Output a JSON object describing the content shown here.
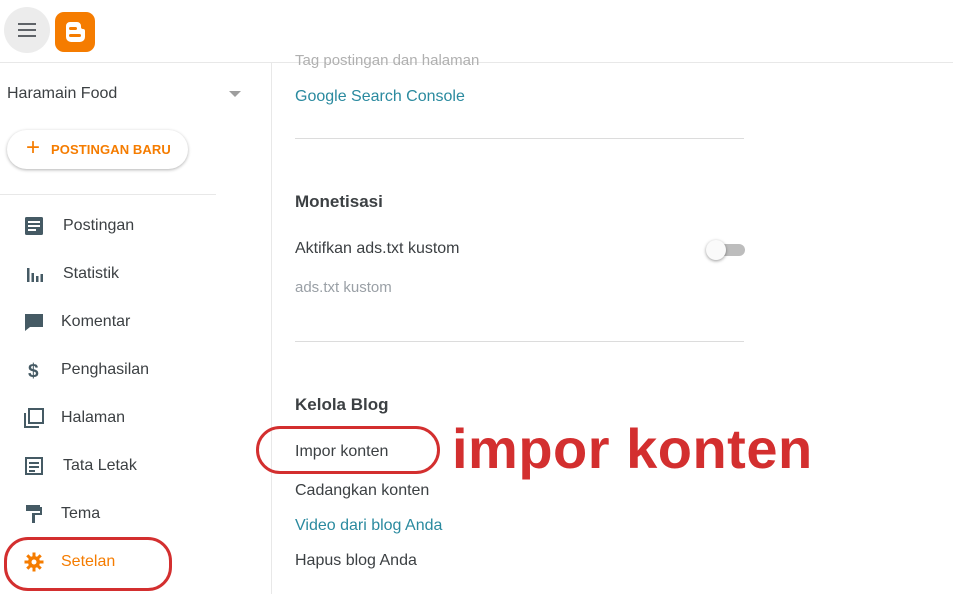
{
  "header": {
    "menu_icon": "hamburger-menu-icon",
    "logo_icon": "blogger-logo-icon",
    "logo_color": "#f57c00"
  },
  "sidebar": {
    "blog_name": "Haramain Food",
    "new_post_label": "POSTINGAN BARU",
    "items": [
      {
        "label": "Postingan",
        "icon": "posts-icon"
      },
      {
        "label": "Statistik",
        "icon": "stats-icon"
      },
      {
        "label": "Komentar",
        "icon": "comment-icon"
      },
      {
        "label": "Penghasilan",
        "icon": "dollar-icon"
      },
      {
        "label": "Halaman",
        "icon": "pages-icon"
      },
      {
        "label": "Tata Letak",
        "icon": "layout-icon"
      },
      {
        "label": "Tema",
        "icon": "theme-icon"
      },
      {
        "label": "Setelan",
        "icon": "gear-icon",
        "active": true
      }
    ]
  },
  "main": {
    "faded_text": "Tag postingan dan halaman",
    "search_console_link": "Google Search Console",
    "monetization": {
      "title": "Monetisasi",
      "ads_toggle_label": "Aktifkan ads.txt kustom",
      "ads_toggle_on": false,
      "ads_placeholder": "ads.txt kustom"
    },
    "manage": {
      "title": "Kelola Blog",
      "import": "Impor konten",
      "backup": "Cadangkan konten",
      "videos": "Video dari blog Anda",
      "delete": "Hapus blog Anda"
    }
  },
  "annotation": {
    "text": "impor konten",
    "color": "#d32f2f"
  }
}
